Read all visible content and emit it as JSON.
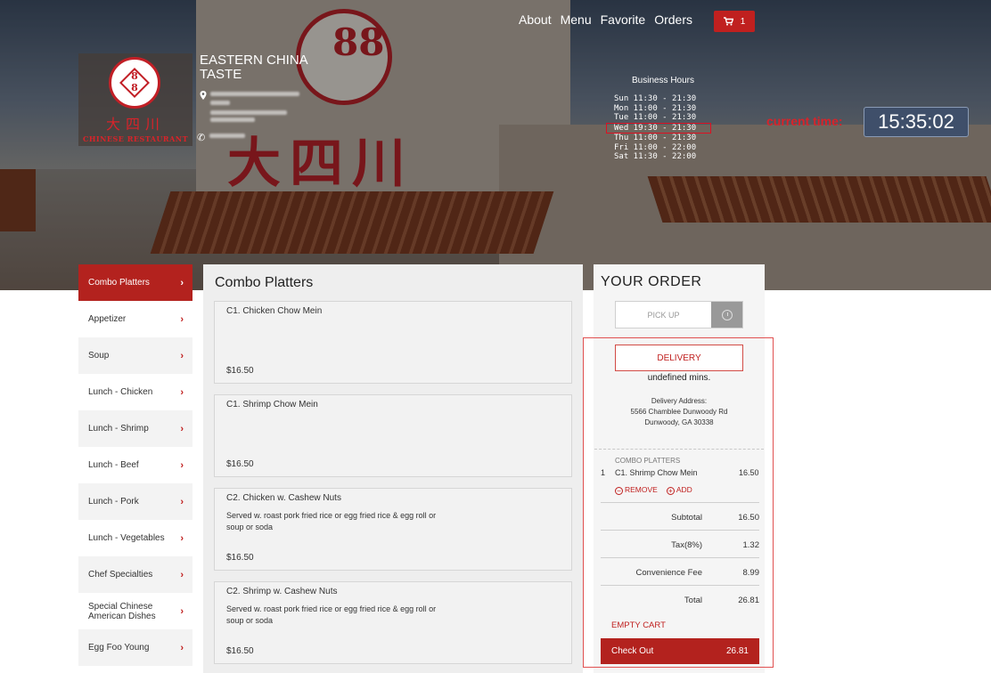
{
  "nav": {
    "links": [
      "About",
      "Menu",
      "Favorite",
      "Orders"
    ],
    "cart_count": "1"
  },
  "restaurant": {
    "name_line1": "EASTERN CHINA",
    "name_line2": "TASTE",
    "logo_digits": "88",
    "logo_chinese": "大四川",
    "logo_english": "CHINESE RESTAURANT"
  },
  "hours": {
    "title": "Business Hours",
    "days": [
      "Sun 11:30 - 21:30",
      "Mon 11:00 - 21:30",
      "Tue 11:00 - 21:30",
      "Wed 19:30 - 21:30",
      "Thu 11:00 - 21:30",
      "Fri 11:00 - 22:00",
      "Sat 11:30 - 22:00"
    ]
  },
  "clock": {
    "label": "current time:",
    "time": "15:35:02"
  },
  "categories": [
    "Combo Platters",
    "Appetizer",
    "Soup",
    "Lunch - Chicken",
    "Lunch - Shrimp",
    "Lunch - Beef",
    "Lunch - Pork",
    "Lunch - Vegetables",
    "Chef Specialties",
    "Special Chinese American Dishes",
    "Egg Foo Young"
  ],
  "menu": {
    "title": "Combo Platters",
    "items": [
      {
        "name": "C1. Chicken Chow Mein",
        "desc": "",
        "price": "$16.50"
      },
      {
        "name": "C1. Shrimp Chow Mein",
        "desc": "",
        "price": "$16.50"
      },
      {
        "name": "C2. Chicken w. Cashew Nuts",
        "desc": "Served w. roast pork fried rice or egg fried rice & egg roll or soup or soda",
        "price": "$16.50"
      },
      {
        "name": "C2. Shrimp w. Cashew Nuts",
        "desc": "Served w. roast pork fried rice or egg fried rice & egg roll or soup or soda",
        "price": "$16.50"
      }
    ]
  },
  "order": {
    "title": "YOUR ORDER",
    "pickup_label": "PICK UP",
    "delivery_label": "DELIVERY",
    "mins": "undefined mins.",
    "address_label": "Delivery Address:",
    "address_line1": "5566 Chamblee Dunwoody Rd",
    "address_line2": "Dunwoody, GA 30338",
    "group": "COMBO PLATTERS",
    "line": {
      "qty": "1",
      "name": "C1. Shrimp Chow Mein",
      "price": "16.50"
    },
    "remove_label": "REMOVE",
    "add_label": "ADD",
    "subtotal_label": "Subtotal",
    "subtotal": "16.50",
    "tax_label": "Tax(8%)",
    "tax": "1.32",
    "fee_label": "Convenience Fee",
    "fee": "8.99",
    "total_label": "Total",
    "total": "26.81",
    "empty_label": "EMPTY CART",
    "checkout_label": "Check Out",
    "checkout_total": "26.81"
  },
  "colors": {
    "brand_red": "#b3221e",
    "clock_bg": "#3f4f6a"
  }
}
